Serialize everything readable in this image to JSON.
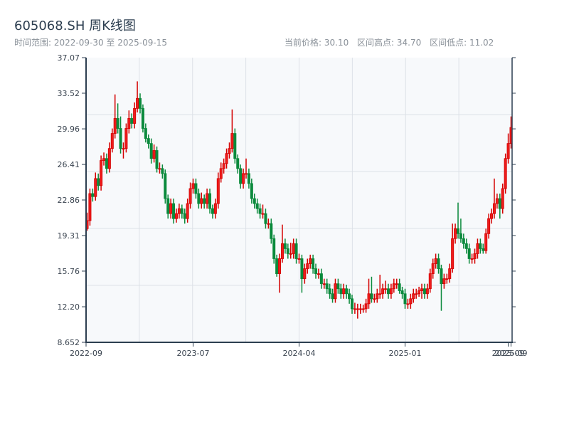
{
  "header": {
    "title": "605068.SH 周K线图",
    "range_text": "时间范围: 2022-09-30 至 2025-09-15",
    "current_price": "当前价格: 30.10",
    "range_high": "区间高点: 34.70",
    "range_low": "区间低点: 11.02"
  },
  "colors": {
    "up": "#d40000",
    "up_fill": "#ee1c1c",
    "down": "#0b8a3c",
    "axis": "#2c3e50",
    "grid": "#dde1e7",
    "plot_bg": "#f7f9fb"
  },
  "chart_data": {
    "type": "candlestick",
    "title": "605068.SH 周K线图",
    "ylim": [
      8.652,
      37.07
    ],
    "y_ticks": [
      "37.07",
      "33.52",
      "29.96",
      "26.41",
      "22.86",
      "19.31",
      "15.76",
      "12.20",
      "8.652"
    ],
    "x_ticks": [
      {
        "index": 0,
        "label": "2022-09"
      },
      {
        "index": 38,
        "label": "2023-07"
      },
      {
        "index": 76,
        "label": "2024-04"
      },
      {
        "index": 114,
        "label": "2025-01"
      },
      {
        "index": 151,
        "label": "2025-09"
      },
      {
        "index": 152,
        "label": "2025-09"
      }
    ],
    "grid": true,
    "ohlc_columns": [
      "open",
      "high",
      "low",
      "close"
    ],
    "ohlc": [
      [
        20.0,
        21.6,
        19.8,
        20.8
      ],
      [
        20.8,
        24.0,
        20.3,
        23.5
      ],
      [
        23.5,
        24.0,
        22.7,
        23.2
      ],
      [
        23.2,
        25.6,
        22.8,
        25.0
      ],
      [
        25.0,
        25.5,
        23.8,
        24.3
      ],
      [
        24.3,
        27.3,
        23.8,
        26.8
      ],
      [
        26.8,
        27.6,
        26.3,
        27.0
      ],
      [
        27.0,
        27.5,
        25.5,
        26.0
      ],
      [
        26.0,
        28.6,
        25.6,
        28.0
      ],
      [
        28.0,
        30.0,
        27.6,
        29.5
      ],
      [
        29.5,
        33.4,
        29.0,
        31.0
      ],
      [
        31.0,
        32.5,
        29.5,
        30.0
      ],
      [
        30.0,
        31.2,
        27.5,
        28.0
      ],
      [
        28.0,
        28.6,
        27.0,
        28.0
      ],
      [
        28.0,
        30.5,
        27.6,
        30.0
      ],
      [
        30.0,
        31.8,
        29.5,
        31.0
      ],
      [
        31.0,
        31.5,
        30.0,
        30.5
      ],
      [
        30.5,
        32.6,
        30.0,
        32.0
      ],
      [
        32.0,
        34.7,
        31.6,
        33.0
      ],
      [
        33.0,
        33.5,
        31.5,
        32.0
      ],
      [
        32.0,
        32.4,
        29.6,
        30.0
      ],
      [
        30.0,
        30.5,
        28.6,
        29.0
      ],
      [
        29.0,
        29.4,
        28.0,
        28.5
      ],
      [
        28.5,
        29.0,
        26.5,
        27.0
      ],
      [
        27.0,
        28.4,
        26.6,
        27.8
      ],
      [
        27.8,
        28.2,
        25.6,
        26.0
      ],
      [
        26.0,
        26.6,
        25.5,
        26.0
      ],
      [
        26.0,
        26.4,
        25.0,
        25.5
      ],
      [
        25.5,
        25.9,
        22.5,
        23.0
      ],
      [
        23.0,
        23.4,
        21.0,
        21.5
      ],
      [
        21.5,
        23.0,
        21.0,
        22.5
      ],
      [
        22.5,
        23.0,
        20.5,
        21.0
      ],
      [
        21.0,
        22.0,
        20.6,
        21.5
      ],
      [
        21.5,
        22.5,
        21.0,
        22.0
      ],
      [
        22.0,
        22.4,
        21.0,
        21.5
      ],
      [
        21.5,
        22.0,
        20.5,
        21.0
      ],
      [
        21.0,
        23.0,
        20.6,
        22.5
      ],
      [
        22.5,
        24.6,
        22.0,
        24.0
      ],
      [
        24.0,
        25.0,
        23.5,
        24.5
      ],
      [
        24.5,
        25.0,
        23.0,
        23.5
      ],
      [
        23.5,
        24.0,
        22.0,
        22.5
      ],
      [
        22.5,
        23.6,
        22.0,
        23.0
      ],
      [
        23.0,
        23.4,
        22.0,
        22.5
      ],
      [
        22.5,
        24.0,
        22.0,
        23.5
      ],
      [
        23.5,
        24.0,
        21.5,
        22.0
      ],
      [
        22.0,
        22.4,
        21.0,
        21.5
      ],
      [
        21.5,
        23.0,
        21.0,
        22.5
      ],
      [
        22.5,
        25.6,
        22.0,
        25.0
      ],
      [
        25.0,
        26.6,
        24.6,
        26.0
      ],
      [
        26.0,
        27.0,
        25.5,
        26.5
      ],
      [
        26.5,
        28.0,
        26.0,
        27.5
      ],
      [
        27.5,
        28.6,
        27.0,
        28.0
      ],
      [
        28.0,
        31.9,
        27.6,
        29.5
      ],
      [
        29.5,
        30.0,
        26.5,
        27.0
      ],
      [
        27.0,
        27.4,
        25.5,
        26.0
      ],
      [
        26.0,
        26.4,
        24.0,
        24.5
      ],
      [
        24.5,
        26.0,
        24.0,
        25.5
      ],
      [
        25.5,
        27.0,
        25.0,
        25.5
      ],
      [
        25.5,
        26.0,
        24.0,
        24.5
      ],
      [
        24.5,
        25.0,
        22.5,
        23.0
      ],
      [
        23.0,
        23.5,
        22.0,
        22.5
      ],
      [
        22.5,
        23.0,
        21.5,
        22.0
      ],
      [
        22.0,
        22.5,
        21.0,
        21.5
      ],
      [
        21.5,
        22.4,
        21.0,
        21.5
      ],
      [
        21.5,
        22.0,
        20.0,
        20.5
      ],
      [
        20.5,
        21.0,
        20.0,
        20.5
      ],
      [
        20.5,
        21.0,
        18.5,
        19.0
      ],
      [
        19.0,
        19.4,
        16.5,
        17.0
      ],
      [
        17.0,
        17.4,
        15.2,
        15.5
      ],
      [
        15.5,
        17.5,
        13.6,
        17.0
      ],
      [
        17.0,
        20.4,
        16.6,
        18.5
      ],
      [
        18.5,
        19.0,
        17.5,
        18.0
      ],
      [
        18.0,
        18.5,
        17.0,
        17.5
      ],
      [
        17.5,
        18.6,
        17.0,
        17.5
      ],
      [
        17.5,
        19.0,
        17.0,
        18.5
      ],
      [
        18.5,
        19.0,
        16.5,
        17.0
      ],
      [
        17.0,
        17.5,
        16.5,
        17.0
      ],
      [
        17.0,
        17.4,
        13.6,
        15.0
      ],
      [
        15.0,
        16.5,
        14.5,
        16.0
      ],
      [
        16.0,
        17.0,
        15.5,
        16.5
      ],
      [
        16.5,
        17.4,
        16.0,
        17.0
      ],
      [
        17.0,
        17.4,
        15.5,
        16.0
      ],
      [
        16.0,
        16.5,
        15.0,
        15.5
      ],
      [
        15.5,
        16.0,
        15.0,
        15.5
      ],
      [
        15.5,
        16.0,
        14.0,
        14.5
      ],
      [
        14.5,
        15.0,
        14.0,
        14.5
      ],
      [
        14.5,
        15.0,
        13.5,
        14.0
      ],
      [
        14.0,
        14.5,
        13.0,
        13.5
      ],
      [
        13.5,
        14.0,
        12.6,
        13.0
      ],
      [
        13.0,
        15.0,
        12.6,
        14.5
      ],
      [
        14.5,
        15.0,
        13.5,
        14.0
      ],
      [
        14.0,
        14.5,
        13.0,
        13.5
      ],
      [
        13.5,
        14.5,
        13.0,
        14.0
      ],
      [
        14.0,
        14.4,
        13.0,
        13.5
      ],
      [
        13.5,
        14.0,
        12.5,
        13.0
      ],
      [
        13.0,
        13.4,
        11.5,
        12.0
      ],
      [
        12.0,
        12.6,
        11.5,
        12.0
      ],
      [
        12.0,
        12.5,
        11.02,
        12.0
      ],
      [
        12.0,
        12.5,
        11.5,
        12.0
      ],
      [
        12.0,
        12.4,
        11.6,
        12.0
      ],
      [
        12.0,
        13.0,
        11.6,
        12.5
      ],
      [
        12.5,
        15.0,
        12.0,
        13.5
      ],
      [
        13.5,
        15.2,
        12.6,
        13.0
      ],
      [
        13.0,
        13.5,
        12.6,
        13.0
      ],
      [
        13.0,
        14.0,
        12.6,
        13.5
      ],
      [
        13.5,
        15.4,
        13.0,
        13.5
      ],
      [
        13.5,
        14.5,
        13.0,
        14.0
      ],
      [
        14.0,
        14.8,
        13.5,
        14.0
      ],
      [
        14.0,
        14.5,
        13.0,
        13.5
      ],
      [
        13.5,
        14.5,
        13.0,
        14.0
      ],
      [
        14.0,
        15.0,
        13.6,
        14.5
      ],
      [
        14.5,
        15.0,
        14.0,
        14.5
      ],
      [
        14.5,
        15.0,
        13.5,
        13.8
      ],
      [
        13.8,
        14.2,
        13.0,
        13.5
      ],
      [
        13.5,
        14.0,
        12.0,
        12.5
      ],
      [
        12.5,
        13.0,
        12.0,
        12.5
      ],
      [
        12.5,
        13.5,
        12.0,
        13.0
      ],
      [
        13.0,
        14.0,
        12.6,
        13.5
      ],
      [
        13.5,
        14.0,
        13.0,
        13.5
      ],
      [
        13.5,
        14.2,
        13.2,
        13.8
      ],
      [
        13.8,
        14.5,
        13.0,
        14.0
      ],
      [
        14.0,
        14.5,
        13.0,
        13.5
      ],
      [
        13.5,
        14.5,
        13.0,
        14.0
      ],
      [
        14.0,
        16.0,
        13.6,
        15.5
      ],
      [
        15.5,
        17.0,
        15.0,
        16.5
      ],
      [
        16.5,
        17.5,
        16.0,
        17.0
      ],
      [
        17.0,
        17.5,
        15.5,
        16.0
      ],
      [
        16.0,
        16.4,
        11.8,
        14.5
      ],
      [
        14.5,
        15.5,
        14.0,
        15.0
      ],
      [
        15.0,
        15.5,
        14.5,
        15.0
      ],
      [
        15.0,
        16.5,
        14.6,
        16.0
      ],
      [
        16.0,
        20.5,
        15.6,
        19.0
      ],
      [
        19.0,
        20.5,
        18.5,
        20.0
      ],
      [
        20.0,
        22.6,
        19.0,
        19.5
      ],
      [
        19.5,
        21.0,
        18.6,
        19.0
      ],
      [
        19.0,
        19.5,
        18.0,
        18.5
      ],
      [
        18.5,
        19.0,
        17.5,
        18.0
      ],
      [
        18.0,
        18.5,
        16.5,
        17.0
      ],
      [
        17.0,
        17.5,
        16.5,
        17.0
      ],
      [
        17.0,
        18.0,
        16.5,
        17.5
      ],
      [
        17.5,
        19.0,
        17.0,
        18.5
      ],
      [
        18.5,
        19.0,
        17.5,
        18.0
      ],
      [
        18.0,
        18.5,
        17.5,
        17.8
      ],
      [
        17.8,
        20.0,
        17.5,
        19.5
      ],
      [
        19.5,
        21.5,
        19.0,
        21.0
      ],
      [
        21.0,
        22.0,
        20.5,
        21.5
      ],
      [
        21.5,
        25.0,
        21.0,
        22.5
      ],
      [
        22.5,
        23.5,
        22.0,
        23.0
      ],
      [
        23.0,
        23.5,
        21.0,
        22.0
      ],
      [
        22.0,
        24.5,
        21.5,
        24.0
      ],
      [
        24.0,
        27.5,
        23.5,
        27.0
      ],
      [
        27.0,
        29.5,
        26.5,
        28.5
      ],
      [
        28.5,
        31.2,
        28.0,
        30.1
      ]
    ]
  }
}
